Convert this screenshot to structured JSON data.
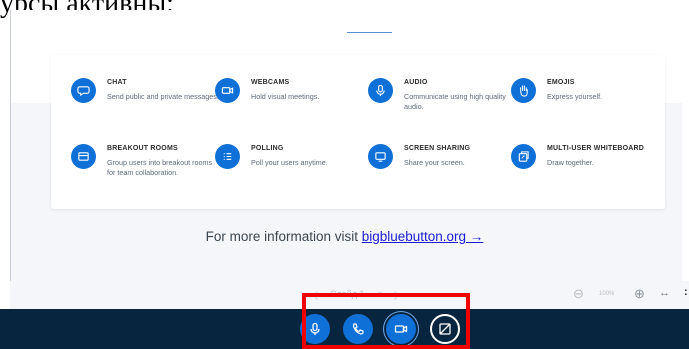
{
  "caption": "урсы активны:",
  "features": [
    {
      "title": "CHAT",
      "desc": "Send public and private messages.",
      "icon": "chat-icon"
    },
    {
      "title": "WEBCAMS",
      "desc": "Hold visual meetings.",
      "icon": "webcam-icon"
    },
    {
      "title": "AUDIO",
      "desc": "Communicate using high quality audio.",
      "icon": "microphone-icon"
    },
    {
      "title": "EMOJIS",
      "desc": "Express yourself.",
      "icon": "hand-icon"
    },
    {
      "title": "BREAKOUT ROOMS",
      "desc": "Group users into breakout rooms for team collaboration.",
      "icon": "breakout-rooms-icon"
    },
    {
      "title": "POLLING",
      "desc": "Poll your users anytime.",
      "icon": "polling-icon"
    },
    {
      "title": "SCREEN SHARING",
      "desc": "Share your screen.",
      "icon": "screen-share-icon"
    },
    {
      "title": "MULTI-USER WHITEBOARD",
      "desc": "Draw together.",
      "icon": "whiteboard-icon"
    }
  ],
  "info": {
    "prefix": "For more information visit ",
    "link": "bigbluebutton.org →"
  },
  "slide_nav": {
    "prev": "〈",
    "slide_label": "Слайд 1",
    "dropdown": "⌄",
    "next": "〉",
    "zoom_out": "⊖",
    "zoom": "100%",
    "zoom_in": "⊕",
    "fit": "↔",
    "more": ":"
  },
  "colors": {
    "accent": "#0f70d7",
    "bar": "#08253f",
    "highlight": "#f20000",
    "link": "#1b1bd0"
  }
}
